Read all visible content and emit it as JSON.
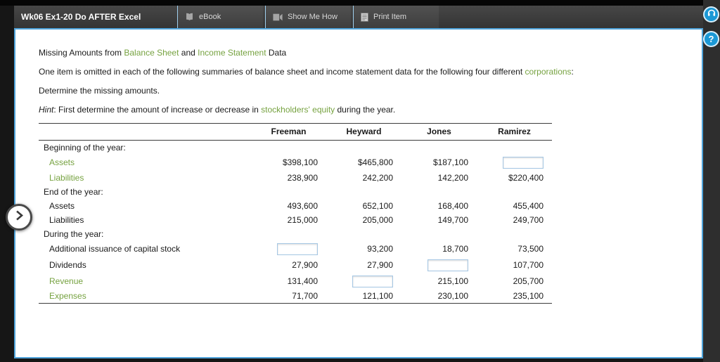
{
  "header": {
    "title": "Wk06 Ex1-20 Do AFTER Excel",
    "tabs": [
      {
        "label": "eBook",
        "icon": "ebook-icon"
      },
      {
        "label": "Show Me How",
        "icon": "show-me-how-icon"
      },
      {
        "label": "Print Item",
        "icon": "print-item-icon"
      }
    ]
  },
  "rail": {
    "audio_button": "audio-support",
    "help_button_label": "?"
  },
  "content": {
    "title": {
      "t1": "Missing Amounts from ",
      "link1": "Balance Sheet",
      "t2": " and ",
      "link2": "Income Statement",
      "t3": " Data"
    },
    "intro": {
      "t1": "One item is omitted in each of the following summaries of balance sheet and income statement data for the following four different ",
      "link1": "corporations",
      "t2": ":"
    },
    "instruction": "Determine the missing amounts.",
    "hint": {
      "label": "Hint",
      "t1": ": First determine the amount of increase or decrease in ",
      "link1": "stockholders' equity",
      "t2": " during the year."
    }
  },
  "table": {
    "columns": [
      "Freeman",
      "Heyward",
      "Jones",
      "Ramirez"
    ],
    "rows": [
      {
        "label": "Beginning of the year:",
        "section": true,
        "cells": [
          "",
          "",
          "",
          ""
        ]
      },
      {
        "label": "Assets",
        "green": true,
        "cells": [
          "$398,100",
          "$465,800",
          "$187,100",
          null
        ]
      },
      {
        "label": "Liabilities",
        "green": true,
        "cells": [
          "238,900",
          "242,200",
          "142,200",
          "$220,400"
        ]
      },
      {
        "label": "End of the year:",
        "section": true,
        "cells": [
          "",
          "",
          "",
          ""
        ]
      },
      {
        "label": "Assets",
        "cells": [
          "493,600",
          "652,100",
          "168,400",
          "455,400"
        ]
      },
      {
        "label": "Liabilities",
        "cells": [
          "215,000",
          "205,000",
          "149,700",
          "249,700"
        ]
      },
      {
        "label": "During the year:",
        "section": true,
        "cells": [
          "",
          "",
          "",
          ""
        ]
      },
      {
        "label": "Additional issuance of capital stock",
        "cells": [
          null,
          "93,200",
          "18,700",
          "73,500"
        ]
      },
      {
        "label": "Dividends",
        "cells": [
          "27,900",
          "27,900",
          null,
          "107,700"
        ]
      },
      {
        "label": "Revenue",
        "green": true,
        "cells": [
          "131,400",
          null,
          "215,100",
          "205,700"
        ]
      },
      {
        "label": "Expenses",
        "green": true,
        "cells": [
          "71,700",
          "121,100",
          "230,100",
          "235,100"
        ]
      }
    ]
  },
  "colors": {
    "accent_blue": "#4fa3da",
    "link_green": "#76a240",
    "icon_blue": "#1b98d5",
    "header_dark": "#3f3f3f"
  }
}
